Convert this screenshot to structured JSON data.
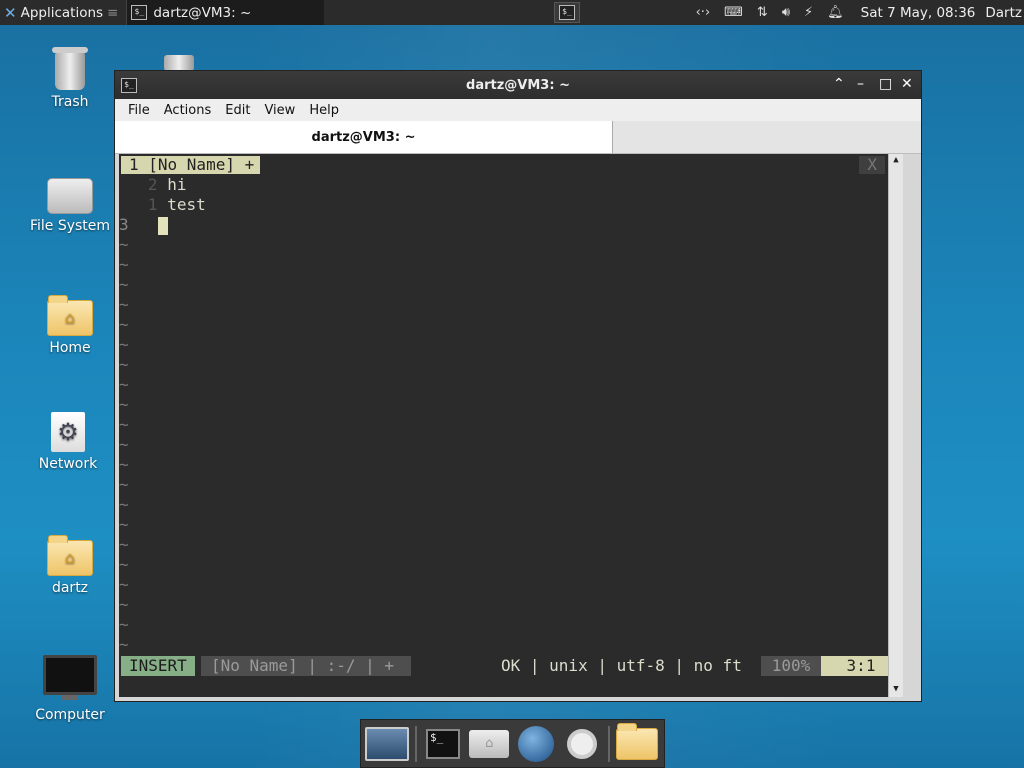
{
  "panel": {
    "apps_label": "Applications",
    "task_label": "dartz@VM3: ~",
    "clock": "Sat  7 May, 08:36",
    "user": "Dartz"
  },
  "desktop": {
    "icons": [
      {
        "label": "Trash"
      },
      {
        "label": "File System"
      },
      {
        "label": "Home"
      },
      {
        "label": "Network"
      },
      {
        "label": "dartz"
      },
      {
        "label": "Computer"
      }
    ]
  },
  "window": {
    "title": "dartz@VM3: ~",
    "menu": [
      "File",
      "Actions",
      "Edit",
      "View",
      "Help"
    ],
    "tab_label": "dartz@VM3: ~"
  },
  "vim": {
    "tab": "1 [No Name] +",
    "close": "X",
    "lines": [
      {
        "num": "2",
        "text": "hi"
      },
      {
        "num": "1",
        "text": "test"
      },
      {
        "num": "3",
        "text": ""
      }
    ],
    "tilde": "~",
    "status_mode": "INSERT",
    "status_name": "[No Name] | :-/ | +",
    "status_right": "OK | unix | utf-8 | no ft",
    "status_pct": "100%",
    "status_pos": "3:1"
  }
}
